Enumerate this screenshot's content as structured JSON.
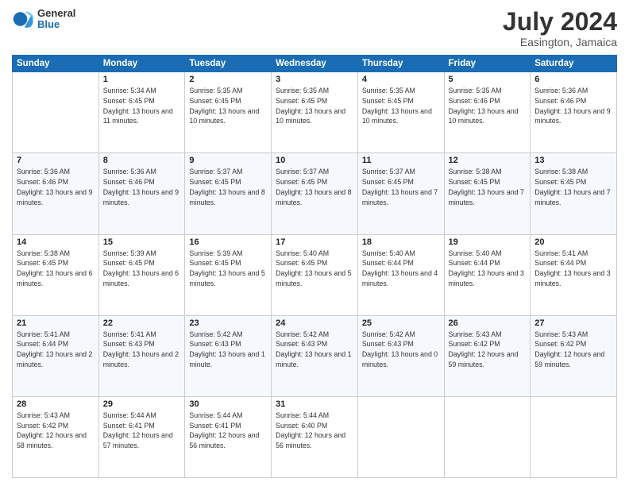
{
  "logo": {
    "line1": "General",
    "line2": "Blue"
  },
  "header": {
    "month": "July 2024",
    "location": "Easington, Jamaica"
  },
  "weekdays": [
    "Sunday",
    "Monday",
    "Tuesday",
    "Wednesday",
    "Thursday",
    "Friday",
    "Saturday"
  ],
  "weeks": [
    [
      {
        "day": "",
        "sunrise": "",
        "sunset": "",
        "daylight": ""
      },
      {
        "day": "1",
        "sunrise": "Sunrise: 5:34 AM",
        "sunset": "Sunset: 6:45 PM",
        "daylight": "Daylight: 13 hours and 11 minutes."
      },
      {
        "day": "2",
        "sunrise": "Sunrise: 5:35 AM",
        "sunset": "Sunset: 6:45 PM",
        "daylight": "Daylight: 13 hours and 10 minutes."
      },
      {
        "day": "3",
        "sunrise": "Sunrise: 5:35 AM",
        "sunset": "Sunset: 6:45 PM",
        "daylight": "Daylight: 13 hours and 10 minutes."
      },
      {
        "day": "4",
        "sunrise": "Sunrise: 5:35 AM",
        "sunset": "Sunset: 6:45 PM",
        "daylight": "Daylight: 13 hours and 10 minutes."
      },
      {
        "day": "5",
        "sunrise": "Sunrise: 5:35 AM",
        "sunset": "Sunset: 6:46 PM",
        "daylight": "Daylight: 13 hours and 10 minutes."
      },
      {
        "day": "6",
        "sunrise": "Sunrise: 5:36 AM",
        "sunset": "Sunset: 6:46 PM",
        "daylight": "Daylight: 13 hours and 9 minutes."
      }
    ],
    [
      {
        "day": "7",
        "sunrise": "Sunrise: 5:36 AM",
        "sunset": "Sunset: 6:46 PM",
        "daylight": "Daylight: 13 hours and 9 minutes."
      },
      {
        "day": "8",
        "sunrise": "Sunrise: 5:36 AM",
        "sunset": "Sunset: 6:46 PM",
        "daylight": "Daylight: 13 hours and 9 minutes."
      },
      {
        "day": "9",
        "sunrise": "Sunrise: 5:37 AM",
        "sunset": "Sunset: 6:45 PM",
        "daylight": "Daylight: 13 hours and 8 minutes."
      },
      {
        "day": "10",
        "sunrise": "Sunrise: 5:37 AM",
        "sunset": "Sunset: 6:45 PM",
        "daylight": "Daylight: 13 hours and 8 minutes."
      },
      {
        "day": "11",
        "sunrise": "Sunrise: 5:37 AM",
        "sunset": "Sunset: 6:45 PM",
        "daylight": "Daylight: 13 hours and 7 minutes."
      },
      {
        "day": "12",
        "sunrise": "Sunrise: 5:38 AM",
        "sunset": "Sunset: 6:45 PM",
        "daylight": "Daylight: 13 hours and 7 minutes."
      },
      {
        "day": "13",
        "sunrise": "Sunrise: 5:38 AM",
        "sunset": "Sunset: 6:45 PM",
        "daylight": "Daylight: 13 hours and 7 minutes."
      }
    ],
    [
      {
        "day": "14",
        "sunrise": "Sunrise: 5:38 AM",
        "sunset": "Sunset: 6:45 PM",
        "daylight": "Daylight: 13 hours and 6 minutes."
      },
      {
        "day": "15",
        "sunrise": "Sunrise: 5:39 AM",
        "sunset": "Sunset: 6:45 PM",
        "daylight": "Daylight: 13 hours and 6 minutes."
      },
      {
        "day": "16",
        "sunrise": "Sunrise: 5:39 AM",
        "sunset": "Sunset: 6:45 PM",
        "daylight": "Daylight: 13 hours and 5 minutes."
      },
      {
        "day": "17",
        "sunrise": "Sunrise: 5:40 AM",
        "sunset": "Sunset: 6:45 PM",
        "daylight": "Daylight: 13 hours and 5 minutes."
      },
      {
        "day": "18",
        "sunrise": "Sunrise: 5:40 AM",
        "sunset": "Sunset: 6:44 PM",
        "daylight": "Daylight: 13 hours and 4 minutes."
      },
      {
        "day": "19",
        "sunrise": "Sunrise: 5:40 AM",
        "sunset": "Sunset: 6:44 PM",
        "daylight": "Daylight: 13 hours and 3 minutes."
      },
      {
        "day": "20",
        "sunrise": "Sunrise: 5:41 AM",
        "sunset": "Sunset: 6:44 PM",
        "daylight": "Daylight: 13 hours and 3 minutes."
      }
    ],
    [
      {
        "day": "21",
        "sunrise": "Sunrise: 5:41 AM",
        "sunset": "Sunset: 6:44 PM",
        "daylight": "Daylight: 13 hours and 2 minutes."
      },
      {
        "day": "22",
        "sunrise": "Sunrise: 5:41 AM",
        "sunset": "Sunset: 6:43 PM",
        "daylight": "Daylight: 13 hours and 2 minutes."
      },
      {
        "day": "23",
        "sunrise": "Sunrise: 5:42 AM",
        "sunset": "Sunset: 6:43 PM",
        "daylight": "Daylight: 13 hours and 1 minute."
      },
      {
        "day": "24",
        "sunrise": "Sunrise: 5:42 AM",
        "sunset": "Sunset: 6:43 PM",
        "daylight": "Daylight: 13 hours and 1 minute."
      },
      {
        "day": "25",
        "sunrise": "Sunrise: 5:42 AM",
        "sunset": "Sunset: 6:43 PM",
        "daylight": "Daylight: 13 hours and 0 minutes."
      },
      {
        "day": "26",
        "sunrise": "Sunrise: 5:43 AM",
        "sunset": "Sunset: 6:42 PM",
        "daylight": "Daylight: 12 hours and 59 minutes."
      },
      {
        "day": "27",
        "sunrise": "Sunrise: 5:43 AM",
        "sunset": "Sunset: 6:42 PM",
        "daylight": "Daylight: 12 hours and 59 minutes."
      }
    ],
    [
      {
        "day": "28",
        "sunrise": "Sunrise: 5:43 AM",
        "sunset": "Sunset: 6:42 PM",
        "daylight": "Daylight: 12 hours and 58 minutes."
      },
      {
        "day": "29",
        "sunrise": "Sunrise: 5:44 AM",
        "sunset": "Sunset: 6:41 PM",
        "daylight": "Daylight: 12 hours and 57 minutes."
      },
      {
        "day": "30",
        "sunrise": "Sunrise: 5:44 AM",
        "sunset": "Sunset: 6:41 PM",
        "daylight": "Daylight: 12 hours and 56 minutes."
      },
      {
        "day": "31",
        "sunrise": "Sunrise: 5:44 AM",
        "sunset": "Sunset: 6:40 PM",
        "daylight": "Daylight: 12 hours and 56 minutes."
      },
      {
        "day": "",
        "sunrise": "",
        "sunset": "",
        "daylight": ""
      },
      {
        "day": "",
        "sunrise": "",
        "sunset": "",
        "daylight": ""
      },
      {
        "day": "",
        "sunrise": "",
        "sunset": "",
        "daylight": ""
      }
    ]
  ]
}
